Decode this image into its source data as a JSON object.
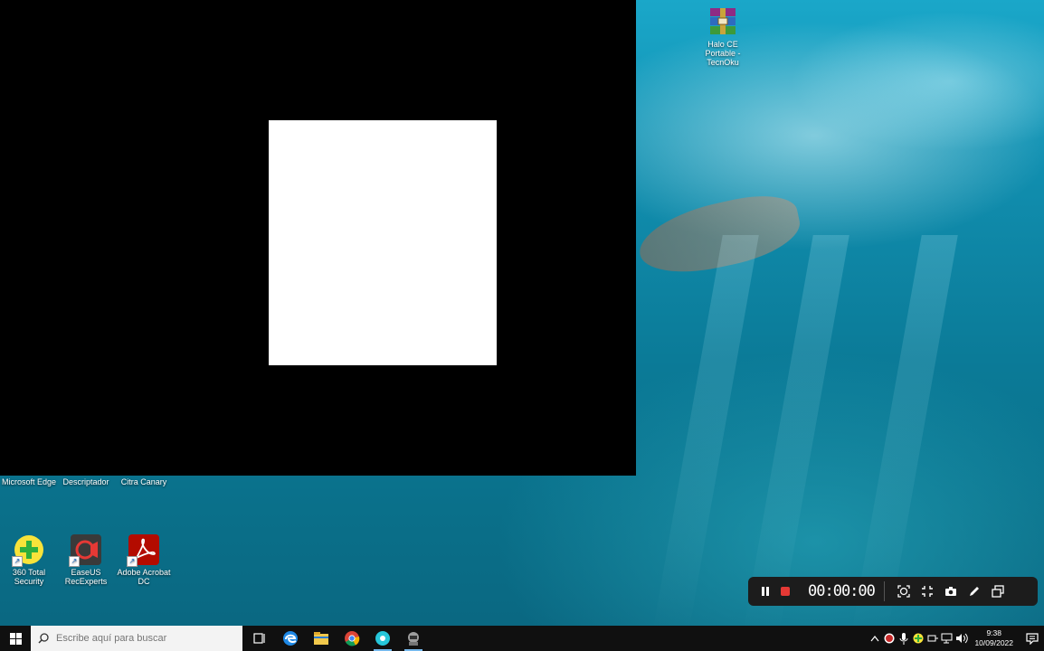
{
  "desktop": {
    "icons": [
      {
        "label": "Halo CE Portable - TecnOku"
      },
      {
        "label": "Microsoft Edge"
      },
      {
        "label": "Descriptador"
      },
      {
        "label": "Citra Canary"
      },
      {
        "label": "360 Total Security"
      },
      {
        "label": "EaseUS RecExperts"
      },
      {
        "label": "Adobe Acrobat DC"
      }
    ]
  },
  "recorder": {
    "timer": "00:00:00",
    "icons": [
      "pause-icon",
      "stop-icon",
      "region-icon",
      "shrink-icon",
      "camera-icon",
      "pen-icon",
      "window-icon"
    ]
  },
  "taskbar": {
    "search_placeholder": "Escribe aquí para buscar",
    "apps": [
      "task-view",
      "edge",
      "file-explorer",
      "chrome",
      "easeus-recexperts",
      "game"
    ],
    "clock": {
      "time": "9:38",
      "date": "10/09/2022"
    }
  },
  "colors": {
    "accent": "#76b9ed",
    "stop_red": "#e53935",
    "taskbar": "#101010"
  }
}
